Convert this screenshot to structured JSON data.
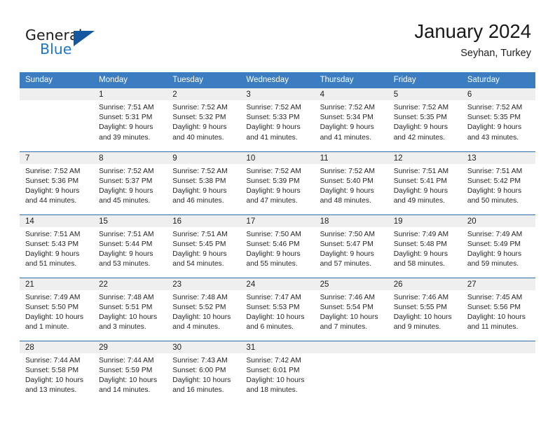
{
  "brand": {
    "name_part1": "General",
    "name_part2": "Blue",
    "triangle_color": "#1458a0",
    "blue_color": "#1c78c8"
  },
  "header": {
    "title": "January 2024",
    "subtitle": "Seyhan, Turkey"
  },
  "theme": {
    "header_bg": "#3b7dc0",
    "row_divider": "#2e6aa8",
    "daynum_bg": "#efefef",
    "text": "#252525"
  },
  "weekday_headers": [
    "Sunday",
    "Monday",
    "Tuesday",
    "Wednesday",
    "Thursday",
    "Friday",
    "Saturday"
  ],
  "weeks": [
    [
      {
        "day": "",
        "sunrise": "",
        "sunset": "",
        "daylight1": "",
        "daylight2": ""
      },
      {
        "day": "1",
        "sunrise": "Sunrise: 7:51 AM",
        "sunset": "Sunset: 5:31 PM",
        "daylight1": "Daylight: 9 hours",
        "daylight2": "and 39 minutes."
      },
      {
        "day": "2",
        "sunrise": "Sunrise: 7:52 AM",
        "sunset": "Sunset: 5:32 PM",
        "daylight1": "Daylight: 9 hours",
        "daylight2": "and 40 minutes."
      },
      {
        "day": "3",
        "sunrise": "Sunrise: 7:52 AM",
        "sunset": "Sunset: 5:33 PM",
        "daylight1": "Daylight: 9 hours",
        "daylight2": "and 41 minutes."
      },
      {
        "day": "4",
        "sunrise": "Sunrise: 7:52 AM",
        "sunset": "Sunset: 5:34 PM",
        "daylight1": "Daylight: 9 hours",
        "daylight2": "and 41 minutes."
      },
      {
        "day": "5",
        "sunrise": "Sunrise: 7:52 AM",
        "sunset": "Sunset: 5:35 PM",
        "daylight1": "Daylight: 9 hours",
        "daylight2": "and 42 minutes."
      },
      {
        "day": "6",
        "sunrise": "Sunrise: 7:52 AM",
        "sunset": "Sunset: 5:35 PM",
        "daylight1": "Daylight: 9 hours",
        "daylight2": "and 43 minutes."
      }
    ],
    [
      {
        "day": "7",
        "sunrise": "Sunrise: 7:52 AM",
        "sunset": "Sunset: 5:36 PM",
        "daylight1": "Daylight: 9 hours",
        "daylight2": "and 44 minutes."
      },
      {
        "day": "8",
        "sunrise": "Sunrise: 7:52 AM",
        "sunset": "Sunset: 5:37 PM",
        "daylight1": "Daylight: 9 hours",
        "daylight2": "and 45 minutes."
      },
      {
        "day": "9",
        "sunrise": "Sunrise: 7:52 AM",
        "sunset": "Sunset: 5:38 PM",
        "daylight1": "Daylight: 9 hours",
        "daylight2": "and 46 minutes."
      },
      {
        "day": "10",
        "sunrise": "Sunrise: 7:52 AM",
        "sunset": "Sunset: 5:39 PM",
        "daylight1": "Daylight: 9 hours",
        "daylight2": "and 47 minutes."
      },
      {
        "day": "11",
        "sunrise": "Sunrise: 7:52 AM",
        "sunset": "Sunset: 5:40 PM",
        "daylight1": "Daylight: 9 hours",
        "daylight2": "and 48 minutes."
      },
      {
        "day": "12",
        "sunrise": "Sunrise: 7:51 AM",
        "sunset": "Sunset: 5:41 PM",
        "daylight1": "Daylight: 9 hours",
        "daylight2": "and 49 minutes."
      },
      {
        "day": "13",
        "sunrise": "Sunrise: 7:51 AM",
        "sunset": "Sunset: 5:42 PM",
        "daylight1": "Daylight: 9 hours",
        "daylight2": "and 50 minutes."
      }
    ],
    [
      {
        "day": "14",
        "sunrise": "Sunrise: 7:51 AM",
        "sunset": "Sunset: 5:43 PM",
        "daylight1": "Daylight: 9 hours",
        "daylight2": "and 51 minutes."
      },
      {
        "day": "15",
        "sunrise": "Sunrise: 7:51 AM",
        "sunset": "Sunset: 5:44 PM",
        "daylight1": "Daylight: 9 hours",
        "daylight2": "and 53 minutes."
      },
      {
        "day": "16",
        "sunrise": "Sunrise: 7:51 AM",
        "sunset": "Sunset: 5:45 PM",
        "daylight1": "Daylight: 9 hours",
        "daylight2": "and 54 minutes."
      },
      {
        "day": "17",
        "sunrise": "Sunrise: 7:50 AM",
        "sunset": "Sunset: 5:46 PM",
        "daylight1": "Daylight: 9 hours",
        "daylight2": "and 55 minutes."
      },
      {
        "day": "18",
        "sunrise": "Sunrise: 7:50 AM",
        "sunset": "Sunset: 5:47 PM",
        "daylight1": "Daylight: 9 hours",
        "daylight2": "and 57 minutes."
      },
      {
        "day": "19",
        "sunrise": "Sunrise: 7:49 AM",
        "sunset": "Sunset: 5:48 PM",
        "daylight1": "Daylight: 9 hours",
        "daylight2": "and 58 minutes."
      },
      {
        "day": "20",
        "sunrise": "Sunrise: 7:49 AM",
        "sunset": "Sunset: 5:49 PM",
        "daylight1": "Daylight: 9 hours",
        "daylight2": "and 59 minutes."
      }
    ],
    [
      {
        "day": "21",
        "sunrise": "Sunrise: 7:49 AM",
        "sunset": "Sunset: 5:50 PM",
        "daylight1": "Daylight: 10 hours",
        "daylight2": "and 1 minute."
      },
      {
        "day": "22",
        "sunrise": "Sunrise: 7:48 AM",
        "sunset": "Sunset: 5:51 PM",
        "daylight1": "Daylight: 10 hours",
        "daylight2": "and 3 minutes."
      },
      {
        "day": "23",
        "sunrise": "Sunrise: 7:48 AM",
        "sunset": "Sunset: 5:52 PM",
        "daylight1": "Daylight: 10 hours",
        "daylight2": "and 4 minutes."
      },
      {
        "day": "24",
        "sunrise": "Sunrise: 7:47 AM",
        "sunset": "Sunset: 5:53 PM",
        "daylight1": "Daylight: 10 hours",
        "daylight2": "and 6 minutes."
      },
      {
        "day": "25",
        "sunrise": "Sunrise: 7:46 AM",
        "sunset": "Sunset: 5:54 PM",
        "daylight1": "Daylight: 10 hours",
        "daylight2": "and 7 minutes."
      },
      {
        "day": "26",
        "sunrise": "Sunrise: 7:46 AM",
        "sunset": "Sunset: 5:55 PM",
        "daylight1": "Daylight: 10 hours",
        "daylight2": "and 9 minutes."
      },
      {
        "day": "27",
        "sunrise": "Sunrise: 7:45 AM",
        "sunset": "Sunset: 5:56 PM",
        "daylight1": "Daylight: 10 hours",
        "daylight2": "and 11 minutes."
      }
    ],
    [
      {
        "day": "28",
        "sunrise": "Sunrise: 7:44 AM",
        "sunset": "Sunset: 5:58 PM",
        "daylight1": "Daylight: 10 hours",
        "daylight2": "and 13 minutes."
      },
      {
        "day": "29",
        "sunrise": "Sunrise: 7:44 AM",
        "sunset": "Sunset: 5:59 PM",
        "daylight1": "Daylight: 10 hours",
        "daylight2": "and 14 minutes."
      },
      {
        "day": "30",
        "sunrise": "Sunrise: 7:43 AM",
        "sunset": "Sunset: 6:00 PM",
        "daylight1": "Daylight: 10 hours",
        "daylight2": "and 16 minutes."
      },
      {
        "day": "31",
        "sunrise": "Sunrise: 7:42 AM",
        "sunset": "Sunset: 6:01 PM",
        "daylight1": "Daylight: 10 hours",
        "daylight2": "and 18 minutes."
      },
      {
        "day": "",
        "sunrise": "",
        "sunset": "",
        "daylight1": "",
        "daylight2": ""
      },
      {
        "day": "",
        "sunrise": "",
        "sunset": "",
        "daylight1": "",
        "daylight2": ""
      },
      {
        "day": "",
        "sunrise": "",
        "sunset": "",
        "daylight1": "",
        "daylight2": ""
      }
    ]
  ]
}
